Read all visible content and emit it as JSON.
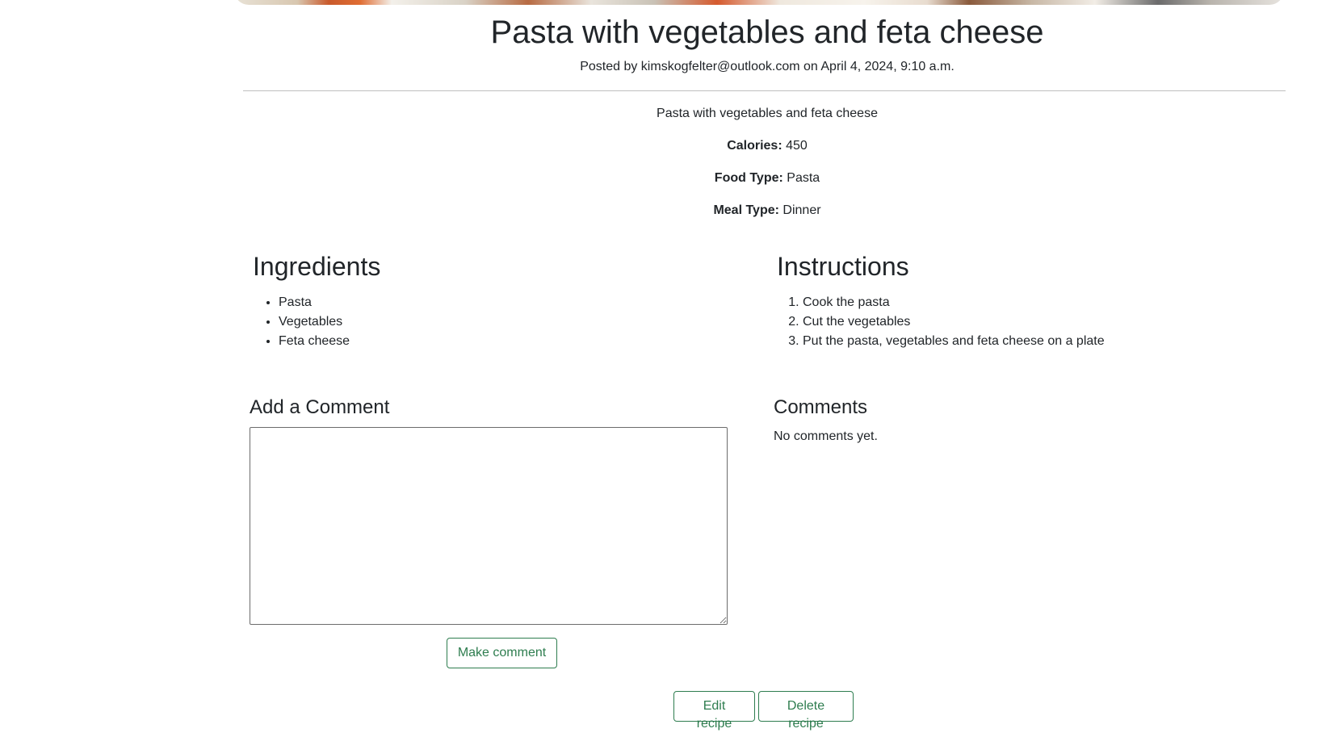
{
  "recipe": {
    "title": "Pasta with vegetables and feta cheese",
    "posted": "Posted by kimskogfelter@outlook.com on April 4, 2024, 9:10 a.m.",
    "description": "Pasta with vegetables and feta cheese",
    "calories_label": "Calories:",
    "calories_value": "450",
    "food_type_label": "Food Type:",
    "food_type_value": "Pasta",
    "meal_type_label": "Meal Type:",
    "meal_type_value": "Dinner"
  },
  "ingredients": {
    "heading": "Ingredients",
    "items": [
      "Pasta",
      "Vegetables",
      "Feta cheese"
    ]
  },
  "instructions": {
    "heading": "Instructions",
    "steps": [
      "Cook the pasta",
      "Cut the vegetables",
      "Put the pasta, vegetables and feta cheese on a plate"
    ]
  },
  "add_comment": {
    "heading": "Add a Comment",
    "textarea_value": "",
    "submit_label": "Make comment"
  },
  "comments": {
    "heading": "Comments",
    "empty_text": "No comments yet."
  },
  "actions": {
    "edit_label": "Edit recipe",
    "delete_label": "Delete recipe"
  },
  "colors": {
    "accent": "#2e7d4f",
    "text": "#212529",
    "divider": "#bfbfbf"
  }
}
